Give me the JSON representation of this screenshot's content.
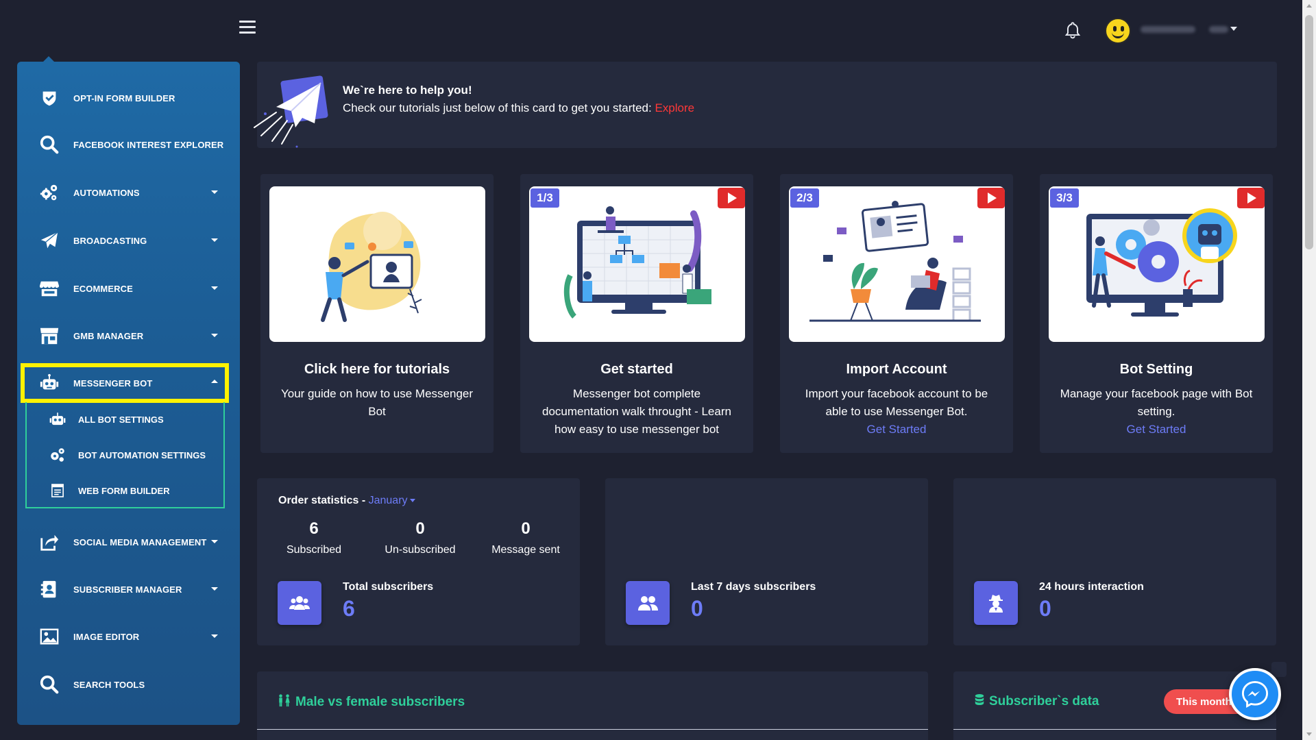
{
  "topbar": {
    "user_name": ""
  },
  "sidebar": {
    "items": [
      {
        "label": "OPT-IN FORM BUILDER",
        "icon": "shield-check-icon",
        "has_dropdown": false
      },
      {
        "label": "FACEBOOK INTEREST EXPLORER",
        "icon": "search-icon",
        "has_dropdown": false
      },
      {
        "label": "AUTOMATIONS",
        "icon": "gears-icon",
        "has_dropdown": true
      },
      {
        "label": "BROADCASTING",
        "icon": "paper-plane-icon",
        "has_dropdown": true
      },
      {
        "label": "ECOMMERCE",
        "icon": "store-icon",
        "has_dropdown": true
      },
      {
        "label": "GMB MANAGER",
        "icon": "shop-icon",
        "has_dropdown": true
      },
      {
        "label": "MESSENGER BOT",
        "icon": "robot-icon",
        "has_dropdown": true,
        "expanded": true
      },
      {
        "label": "SOCIAL MEDIA MANAGEMENT",
        "icon": "share-icon",
        "has_dropdown": true
      },
      {
        "label": "SUBSCRIBER MANAGER",
        "icon": "contact-book-icon",
        "has_dropdown": true
      },
      {
        "label": "IMAGE EDITOR",
        "icon": "image-icon",
        "has_dropdown": true
      },
      {
        "label": "SEARCH TOOLS",
        "icon": "search-icon",
        "has_dropdown": false
      }
    ],
    "submenu": [
      {
        "label": "ALL BOT SETTINGS",
        "icon": "robot-icon"
      },
      {
        "label": "BOT AUTOMATION SETTINGS",
        "icon": "gears-icon"
      },
      {
        "label": "WEB FORM BUILDER",
        "icon": "form-icon"
      }
    ]
  },
  "help": {
    "heading": "We`re here to help you!",
    "text": "Check our tutorials just below of this card to get you started: ",
    "link": "Explore"
  },
  "cards": [
    {
      "badge": "",
      "title": "Click here for tutorials",
      "desc": "Your guide on how to use Messenger Bot",
      "link": ""
    },
    {
      "badge": "1/3",
      "title": "Get started",
      "desc": "Messenger bot complete documentation walk throught - Learn how easy to use messenger bot",
      "link": ""
    },
    {
      "badge": "2/3",
      "title": "Import Account",
      "desc": "Import your facebook account to be able to use Messenger Bot.",
      "link": "Get Started"
    },
    {
      "badge": "3/3",
      "title": "Bot Setting",
      "desc": "Manage your facebook page with Bot setting.",
      "link": "Get Started"
    }
  ],
  "order_stats": {
    "label": "Order statistics - ",
    "month": "January",
    "kpis": [
      {
        "value": "6",
        "caption": "Subscribed"
      },
      {
        "value": "0",
        "caption": "Un-subscribed"
      },
      {
        "value": "0",
        "caption": "Message sent"
      }
    ],
    "total_label": "Total subscribers",
    "total_value": "6"
  },
  "last7": {
    "label": "Last 7 days subscribers",
    "value": "0"
  },
  "interaction": {
    "label": "24 hours interaction",
    "value": "0"
  },
  "bottom": {
    "gender_title": "Male vs female subscribers",
    "subscriber_title": "Subscriber`s data",
    "this_month": "This month"
  },
  "colors": {
    "accent": "#5b62e0",
    "link": "#6d7cf7",
    "danger": "#ff3838",
    "green": "#2fcf9a",
    "highlight": "#fff200"
  }
}
